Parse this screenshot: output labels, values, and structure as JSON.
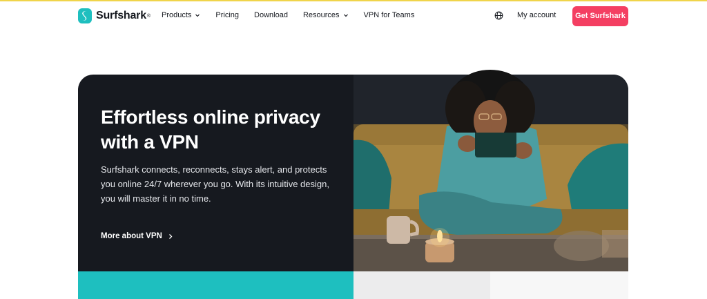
{
  "brand": {
    "name": "Surfshark",
    "mark": "®",
    "color": "#1ebfbf"
  },
  "nav": {
    "items": [
      {
        "label": "Products",
        "has_dropdown": true
      },
      {
        "label": "Pricing",
        "has_dropdown": false
      },
      {
        "label": "Download",
        "has_dropdown": false
      },
      {
        "label": "Resources",
        "has_dropdown": true
      },
      {
        "label": "VPN for Teams",
        "has_dropdown": false
      }
    ],
    "language_icon": "globe-icon",
    "account_label": "My account",
    "cta_label": "Get Surfshark",
    "cta_color": "#f43f62"
  },
  "hero": {
    "title": "Effortless online privacy with a VPN",
    "description": "Surfshark connects, reconnects, stays alert, and protects you online 24/7 wherever you go. With its intuitive design, you will master it in no time.",
    "link_label": "More about VPN",
    "link_icon": "chevron-right-icon",
    "background": "#16191f"
  },
  "strips": {
    "teal": "#1ebfbf",
    "grey": "#ececed",
    "light": "#f7f7f7"
  }
}
